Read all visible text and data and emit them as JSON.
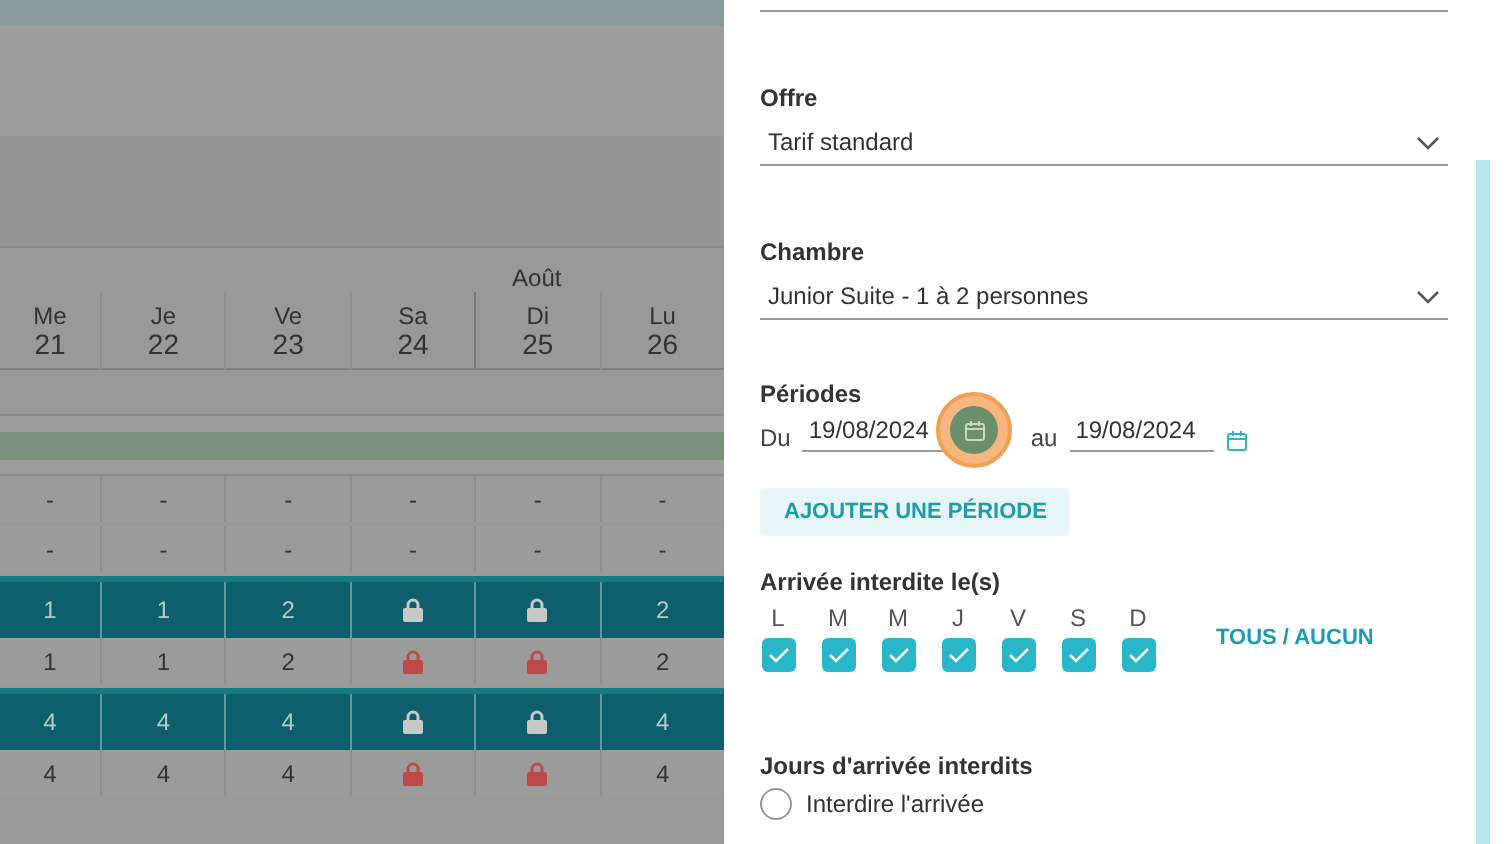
{
  "calendar": {
    "month": "Août",
    "days": [
      {
        "dow": "Me",
        "day": "21"
      },
      {
        "dow": "Je",
        "day": "22"
      },
      {
        "dow": "Ve",
        "day": "23"
      },
      {
        "dow": "Sa",
        "day": "24"
      },
      {
        "dow": "Di",
        "day": "25"
      },
      {
        "dow": "Lu",
        "day": "26"
      }
    ],
    "rows": [
      {
        "kind": "plain",
        "cells": [
          {
            "kind": "text",
            "text": "-"
          },
          {
            "kind": "text",
            "text": "-"
          },
          {
            "kind": "text",
            "text": "-"
          },
          {
            "kind": "text",
            "text": "-"
          },
          {
            "kind": "text",
            "text": "-"
          },
          {
            "kind": "text",
            "text": "-"
          }
        ]
      },
      {
        "kind": "plain",
        "cells": [
          {
            "kind": "text",
            "text": "-"
          },
          {
            "kind": "text",
            "text": "-"
          },
          {
            "kind": "text",
            "text": "-"
          },
          {
            "kind": "text",
            "text": "-"
          },
          {
            "kind": "text",
            "text": "-"
          },
          {
            "kind": "text",
            "text": "-"
          }
        ]
      },
      {
        "kind": "teal",
        "cells": [
          {
            "kind": "text",
            "text": "1"
          },
          {
            "kind": "text",
            "text": "1"
          },
          {
            "kind": "text",
            "text": "2"
          },
          {
            "kind": "lock"
          },
          {
            "kind": "lock"
          },
          {
            "kind": "text",
            "text": "2"
          }
        ]
      },
      {
        "kind": "plain",
        "cells": [
          {
            "kind": "text",
            "text": "1"
          },
          {
            "kind": "text",
            "text": "1"
          },
          {
            "kind": "text",
            "text": "2"
          },
          {
            "kind": "lock"
          },
          {
            "kind": "lock"
          },
          {
            "kind": "text",
            "text": "2"
          }
        ]
      },
      {
        "kind": "teal",
        "cells": [
          {
            "kind": "text",
            "text": "4"
          },
          {
            "kind": "text",
            "text": "4"
          },
          {
            "kind": "text",
            "text": "4"
          },
          {
            "kind": "lock"
          },
          {
            "kind": "lock"
          },
          {
            "kind": "text",
            "text": "4"
          }
        ]
      },
      {
        "kind": "plain",
        "cells": [
          {
            "kind": "text",
            "text": "4"
          },
          {
            "kind": "text",
            "text": "4"
          },
          {
            "kind": "text",
            "text": "4"
          },
          {
            "kind": "lock"
          },
          {
            "kind": "lock"
          },
          {
            "kind": "text",
            "text": "4"
          }
        ]
      }
    ]
  },
  "panel": {
    "offer": {
      "label": "Offre",
      "value": "Tarif standard"
    },
    "room": {
      "label": "Chambre",
      "value": "Junior Suite - 1 à 2 personnes"
    },
    "periods": {
      "label": "Périodes",
      "from_label": "Du",
      "from": "19/08/2024",
      "to_label": "au",
      "to": "19/08/2024"
    },
    "add_button": "AJOUTER UNE PÉRIODE",
    "arrival": {
      "label": "Arrivée interdite le(s)",
      "toggle_all": "TOUS / AUCUN",
      "days": [
        {
          "letter": "L",
          "checked": true
        },
        {
          "letter": "M",
          "checked": true
        },
        {
          "letter": "M",
          "checked": true
        },
        {
          "letter": "J",
          "checked": true
        },
        {
          "letter": "V",
          "checked": true
        },
        {
          "letter": "S",
          "checked": true
        },
        {
          "letter": "D",
          "checked": true
        }
      ]
    },
    "forbidden": {
      "label": "Jours d'arrivée interdits",
      "options": [
        {
          "label": "Interdire l'arrivée",
          "selected": false
        }
      ]
    }
  }
}
